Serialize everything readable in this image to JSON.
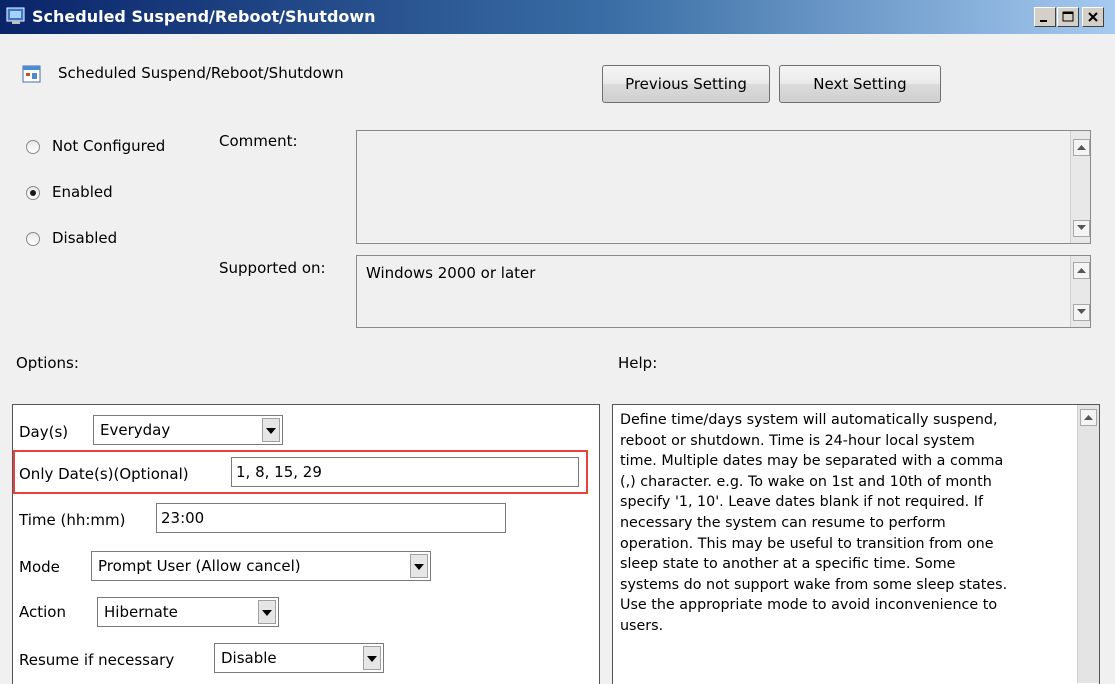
{
  "window": {
    "title": "Scheduled Suspend/Reboot/Shutdown",
    "icon": "policy-setting-icon",
    "controls": [
      "minimize-icon",
      "maximize-icon",
      "close-icon"
    ]
  },
  "header": {
    "setting_name": "Scheduled Suspend/Reboot/Shutdown",
    "previous_label": "Previous Setting",
    "next_label": "Next Setting"
  },
  "state": {
    "options": [
      {
        "label": "Not Configured",
        "checked": false
      },
      {
        "label": "Enabled",
        "checked": true
      },
      {
        "label": "Disabled",
        "checked": false
      }
    ]
  },
  "comment": {
    "label": "Comment:",
    "value": ""
  },
  "supported": {
    "label": "Supported on:",
    "value": "Windows 2000 or later"
  },
  "options_section": {
    "label": "Options:",
    "days_label": "Day(s)",
    "days_value": "Everyday",
    "dates_label": "Only Date(s)(Optional)",
    "dates_value": "1, 8, 15, 29",
    "time_label": "Time (hh:mm)",
    "time_value": "23:00",
    "mode_label": "Mode",
    "mode_value": "Prompt User (Allow cancel)",
    "action_label": "Action",
    "action_value": "Hibernate",
    "resume_label": "Resume if necessary",
    "resume_value": "Disable",
    "highlight_color": "#e8403a"
  },
  "help": {
    "label": "Help:",
    "lines": [
      "Define time/days system will automatically suspend,",
      "reboot or shutdown. Time is 24-hour local system",
      "time. Multiple dates may be separated with a comma",
      "(,) character. e.g. To wake on 1st and 10th of month",
      "specify '1, 10'. Leave dates blank if not required. If",
      "necessary the system can resume to perform",
      "operation. This may be useful to transition from one",
      "sleep state to another at a specific time. Some",
      "systems do not support wake from some sleep states.",
      "Use the appropriate mode to avoid inconvenience to",
      "users."
    ]
  }
}
